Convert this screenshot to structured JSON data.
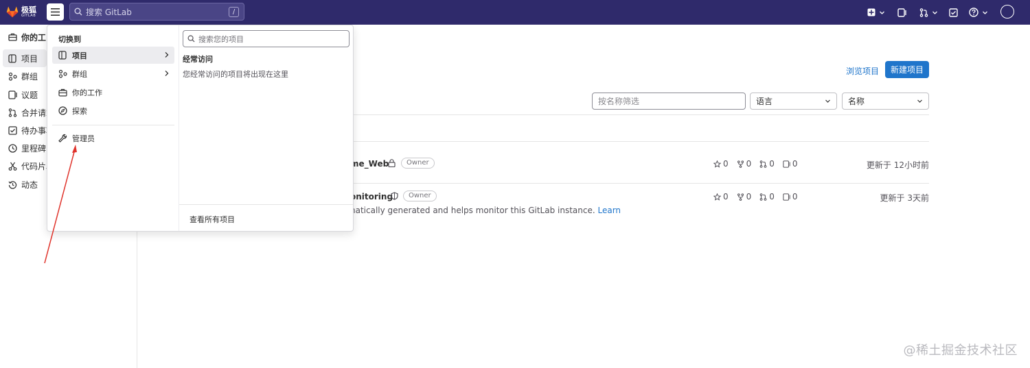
{
  "navbar": {
    "logo_title": "极狐",
    "logo_subtitle": "GITLAB",
    "search_placeholder": "搜索 GitLab",
    "search_shortcut": "/",
    "icons": [
      "plus-square-icon",
      "chevron-down-icon",
      "issues-icon",
      "merge-request-icon",
      "todo-icon",
      "help-icon",
      "avatar-icon"
    ]
  },
  "sidebar": {
    "header": "你的工",
    "items": [
      {
        "label": "项目",
        "icon": "project-icon"
      },
      {
        "label": "群组",
        "icon": "group-icon"
      },
      {
        "label": "议题",
        "icon": "issues-icon"
      },
      {
        "label": "合并请求",
        "icon": "merge-request-icon"
      },
      {
        "label": "待办事项",
        "icon": "todo-icon"
      },
      {
        "label": "里程碑",
        "icon": "milestone-icon"
      },
      {
        "label": "代码片段",
        "icon": "snippet-icon"
      },
      {
        "label": "动态",
        "icon": "history-icon"
      }
    ]
  },
  "dropdown": {
    "switch_to": "切换到",
    "items": [
      {
        "label": "项目",
        "icon": "project-icon",
        "has_submenu": true
      },
      {
        "label": "群组",
        "icon": "group-icon",
        "has_submenu": true
      },
      {
        "label": "你的工作",
        "icon": "work-icon",
        "has_submenu": false
      },
      {
        "label": "探索",
        "icon": "compass-icon",
        "has_submenu": false
      }
    ],
    "admin_label": "管理员",
    "search_placeholder": "搜索您的项目",
    "frequent_title": "经常访问",
    "frequent_empty": "您经常访问的项目将出现在这里",
    "view_all": "查看所有项目"
  },
  "main": {
    "browse_projects": "浏览项目",
    "new_project": "新建项目",
    "filter_placeholder": "按名称筛选",
    "language_select": "语言",
    "sort_select": "名称",
    "projects": [
      {
        "name_visible": "me_Web",
        "badge": "Owner",
        "visibility_icon": "lock-icon",
        "stars": "0",
        "forks": "0",
        "merge_requests": "0",
        "issues": "0",
        "updated": "更新于 12小时前"
      },
      {
        "name_visible": "onitoring",
        "badge": "Owner",
        "visibility_icon": "shield-icon",
        "stars": "0",
        "forks": "0",
        "merge_requests": "0",
        "issues": "0",
        "updated": "更新于 3天前",
        "description_visible": "natically generated and helps monitor this GitLab instance. ",
        "description_link": "Learn"
      }
    ]
  },
  "watermark": "@稀土掘金技术社区",
  "colors": {
    "navbar": "#2f2a6b",
    "primary": "#1f75cb",
    "annotation_arrow": "#e0332b"
  }
}
